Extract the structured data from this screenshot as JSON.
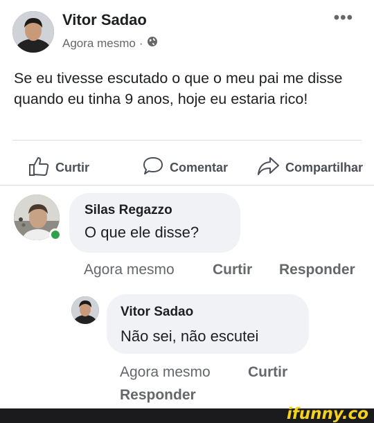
{
  "post": {
    "author": "Vitor Sadao",
    "time": "Agora mesmo",
    "separator": "·",
    "text": "Se eu tivesse escutado o que o meu pai me disse quando eu tinha 9 anos, hoje eu estaria rico!",
    "more": "•••"
  },
  "actions": {
    "like": "Curtir",
    "comment": "Comentar",
    "share": "Compartilhar"
  },
  "comments": [
    {
      "author": "Silas Regazzo",
      "text": "O que ele disse?",
      "time": "Agora mesmo",
      "like": "Curtir",
      "reply": "Responder"
    },
    {
      "author": "Vitor Sadao",
      "text": "Não sei, não escutei",
      "time": "Agora mesmo",
      "like": "Curtir",
      "reply": "Responder"
    }
  ],
  "watermark": "ifunny.co",
  "colors": {
    "text": "#1c1e21",
    "secondary": "#65676b",
    "bubble": "#f0f2f5",
    "online": "#31a24c",
    "watermark": "#f5d21c"
  }
}
